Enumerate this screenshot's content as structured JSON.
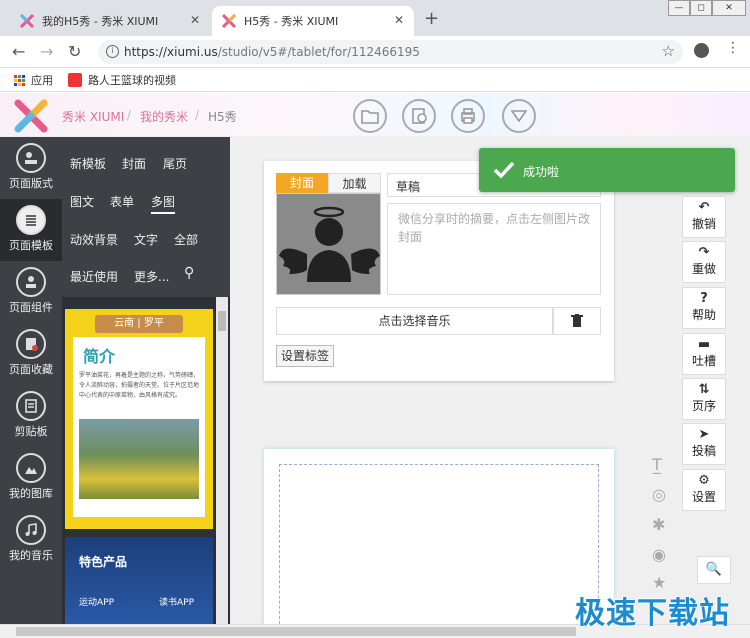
{
  "browser": {
    "tabs": [
      {
        "title": "我的H5秀 - 秀米 XIUMI",
        "active": false
      },
      {
        "title": "H5秀 - 秀米 XIUMI",
        "active": true
      }
    ],
    "new_tab": "+",
    "close": "✕",
    "url_domain": "https://xiumi.us",
    "url_path": "/studio/v5#/tablet/for/112466195",
    "bookmarks": [
      {
        "label": "应用",
        "icon": "apps-grid-icon"
      },
      {
        "label": "路人王篮球的视频",
        "icon": "video-icon"
      }
    ]
  },
  "header": {
    "logo": "xiumi-logo",
    "breadcrumbs": [
      "秀米 XIUMI",
      "我的秀米",
      "H5秀"
    ],
    "separator": "/",
    "tools": [
      "folder-icon",
      "export-icon",
      "print-icon",
      "dropdown-icon"
    ]
  },
  "sidebar": {
    "items": [
      {
        "label": "页面版式",
        "icon": "layout-icon",
        "active": false
      },
      {
        "label": "页面模板",
        "icon": "template-icon",
        "active": true
      },
      {
        "label": "页面组件",
        "icon": "component-icon",
        "active": false
      },
      {
        "label": "页面收藏",
        "icon": "favorite-icon",
        "active": false
      },
      {
        "label": "剪贴板",
        "icon": "clipboard-icon",
        "active": false
      },
      {
        "label": "我的图库",
        "icon": "gallery-icon",
        "active": false
      },
      {
        "label": "我的音乐",
        "icon": "music-icon",
        "active": false
      }
    ]
  },
  "templates": {
    "categories_row1": [
      "新模板",
      "封面",
      "尾页"
    ],
    "categories_row2": [
      "图文",
      "表单",
      "多图"
    ],
    "categories_row3": [
      "动效背景",
      "文字",
      "全部"
    ],
    "categories_row4": [
      "最近使用",
      "更多..."
    ],
    "selected": "多图",
    "thumb1": {
      "banner": "云南 | 罗平",
      "heading": "简介",
      "body": "罗平油菜花，再着是主题的之称，气势磅礴，令人流醉动容，拍摄者的天堂。位于片区范地中心代表的中原菜物，由风格有成究。"
    },
    "thumb2": {
      "heading": "特色产品",
      "items": [
        "运动APP",
        "读书APP"
      ]
    }
  },
  "cover_card": {
    "tabs": [
      "封面",
      "加载"
    ],
    "active_tab": "封面",
    "title_value": "草稿",
    "desc_placeholder": "微信分享时的摘要，点击左侧图片改封面",
    "music_button": "点击选择音乐",
    "tag_button": "设置标签"
  },
  "toast": {
    "message": "成功啦",
    "color": "#4ca84f"
  },
  "right_tools": [
    {
      "label": "撤销",
      "glyph": "↶",
      "icon": "undo-icon"
    },
    {
      "label": "重做",
      "glyph": "↷",
      "icon": "redo-icon"
    },
    {
      "label": "帮助",
      "glyph": "?",
      "icon": "help-icon"
    },
    {
      "label": "吐槽",
      "glyph": "▬",
      "icon": "comment-icon"
    },
    {
      "label": "页序",
      "glyph": "⇅",
      "icon": "sort-icon"
    },
    {
      "label": "投稿",
      "glyph": "➤",
      "icon": "submit-icon"
    },
    {
      "label": "设置",
      "glyph": "⚙",
      "icon": "settings-icon"
    }
  ],
  "mini_tools": [
    "text-icon",
    "play-icon",
    "sparkle-icon",
    "eye-off-icon",
    "star-icon"
  ],
  "zoom": "🔍",
  "watermark": "极速下载站",
  "colors": {
    "accent": "#e0709a",
    "sidebar": "#3e4046",
    "toast": "#4ca84f",
    "watermark": "#1a8ccf"
  }
}
